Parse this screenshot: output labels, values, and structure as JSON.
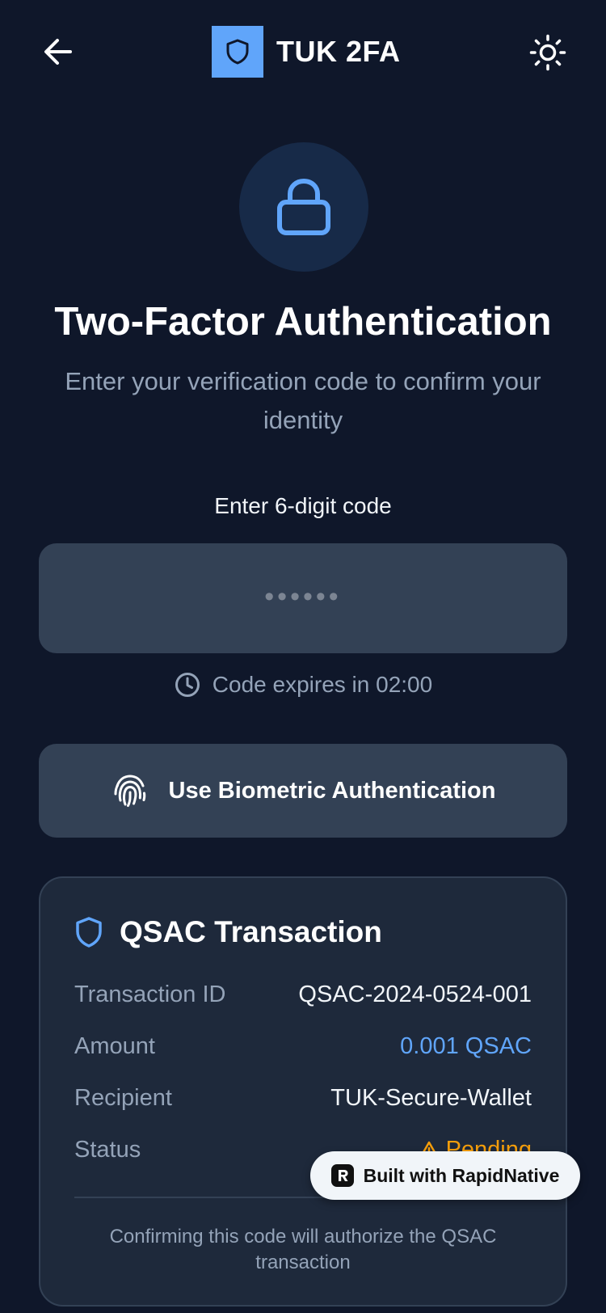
{
  "header": {
    "app_title": "TUK 2FA",
    "back_icon": "arrow-left-icon",
    "logo_icon": "shield-icon",
    "theme_icon": "sun-icon"
  },
  "hero": {
    "icon": "lock-icon",
    "title": "Two-Factor Authentication",
    "subtitle": "Enter your verification code to confirm your identity"
  },
  "code": {
    "label": "Enter 6-digit code",
    "value": "",
    "placeholder": "••••••",
    "expires_text": "Code expires in 02:00"
  },
  "biometric": {
    "icon": "fingerprint-icon",
    "label": "Use Biometric Authentication"
  },
  "transaction": {
    "title": "QSAC Transaction",
    "rows": [
      {
        "label": "Transaction ID",
        "value": "QSAC-2024-0524-001"
      },
      {
        "label": "Amount",
        "value": "0.001 QSAC"
      },
      {
        "label": "Recipient",
        "value": "TUK-Secure-Wallet"
      },
      {
        "label": "Status",
        "value": "Pending"
      }
    ],
    "note": "Confirming this code will authorize the QSAC transaction"
  },
  "badge": {
    "label": "Built with RapidNative"
  },
  "colors": {
    "background": "#0f172a",
    "accent": "#60a5fa",
    "surface": "#334155",
    "card": "#1e293b",
    "warning": "#f59e0b"
  }
}
